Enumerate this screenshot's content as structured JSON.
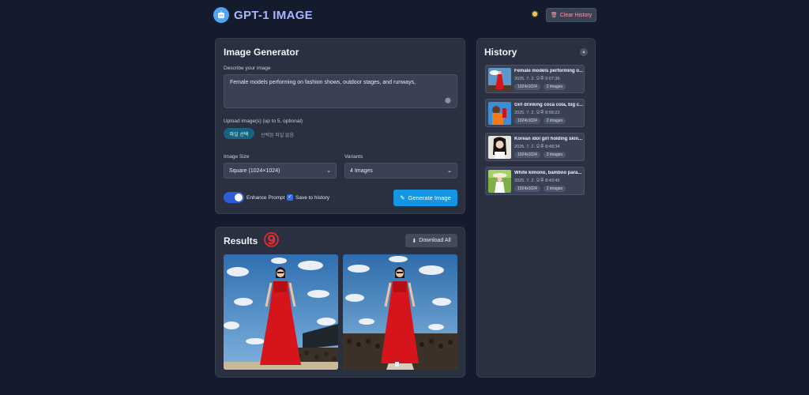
{
  "header": {
    "app_title": "GPT-1 IMAGE",
    "clear_history_label": "Clear History"
  },
  "generator": {
    "title": "Image Generator",
    "describe_label": "Describe your image",
    "prompt_value": "Female models performing on fashion shows, outdoor stages, and runways,",
    "upload_label": "Upload image(s) (up to 5, optional)",
    "file_button_label": "파일 선택",
    "file_status": "선택된 파일 없음",
    "size_label": "Image Size",
    "size_value": "Square (1024×1024)",
    "variants_label": "Variants",
    "variants_value": "4 Images",
    "enhance_label": "Enhance Prompt",
    "enhance_on": true,
    "save_label": "Save to history",
    "save_checked": true,
    "generate_label": "Generate Image"
  },
  "results": {
    "title": "Results",
    "badge": "⑨",
    "download_all_label": "Download All"
  },
  "history": {
    "title": "History",
    "items": [
      {
        "name": "Female models performing o...",
        "date": "2025. 7. 2. 오후 9:07:36",
        "size": "1024x1024",
        "count": "2 images"
      },
      {
        "name": "Girl drinking coca cola, big c...",
        "date": "2025. 7. 2. 오후 8:56:22",
        "size": "1024x1024",
        "count": "2 images"
      },
      {
        "name": "Korean idol girl holding skin...",
        "date": "2025. 7. 2. 오후 8:48:34",
        "size": "1024x1024",
        "count": "2 images"
      },
      {
        "name": "White kimono, bamboo para...",
        "date": "2025. 7. 2. 오후 8:43:45",
        "size": "1024x1024",
        "count": "2 images"
      }
    ]
  },
  "colors": {
    "background": "#141b2d",
    "card": "#2a3040",
    "accent_blue": "#1596e4",
    "title_gradient": "#a7b6ff",
    "clear_text": "#ff9a9a"
  }
}
